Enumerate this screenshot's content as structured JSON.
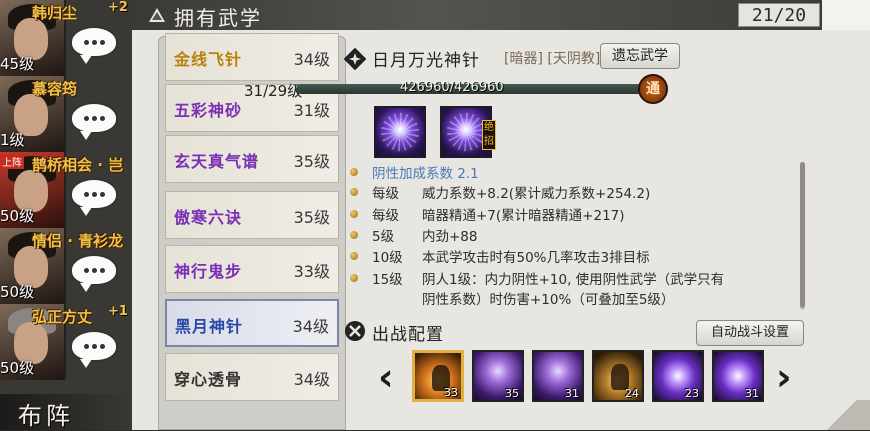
{
  "friends": [
    {
      "name": "韩归尘",
      "level": "45级",
      "extra": "+2",
      "tag": ""
    },
    {
      "name": "慕容筠",
      "level": "1级",
      "extra": "",
      "tag": ""
    },
    {
      "name": "鹊桥相会 · 岂",
      "level": "50级",
      "extra": "",
      "tag": "上阵"
    },
    {
      "name": "情侣 · 青衫龙",
      "level": "50级",
      "extra": "",
      "tag": ""
    },
    {
      "name": "弘正方丈",
      "level": "50级",
      "extra": "+1",
      "tag": ""
    }
  ],
  "formation_label": "布阵",
  "header": {
    "title": "拥有武学",
    "count": "21/20"
  },
  "skills": [
    {
      "name": "金线飞针",
      "level": "34级",
      "color": "gold"
    },
    {
      "name": "五彩神砂",
      "level": "31级",
      "color": "purple"
    },
    {
      "name": "玄天真气谱",
      "level": "35级",
      "color": "purple"
    },
    {
      "name": "傲寒六诀",
      "level": "35级",
      "color": "purple"
    },
    {
      "name": "神行鬼步",
      "level": "33级",
      "color": "purple"
    },
    {
      "name": "黑月神针",
      "level": "34级",
      "color": "blue"
    },
    {
      "name": "穿心透骨",
      "level": "34级",
      "color": "dark"
    }
  ],
  "detail": {
    "name": "日月万光神针",
    "tags": "[暗器] [天阴教]",
    "forget_label": "遗忘武学",
    "level_label": "31/29级",
    "exp_text": "426960/426960",
    "exp_fraction": 1.0,
    "tong_label": "通",
    "ult_label": "绝招"
  },
  "properties": [
    {
      "key": "阴性加成系数",
      "value": "2.1"
    },
    {
      "key": "每级",
      "value": "威力系数+8.2(累计威力系数+254.2)"
    },
    {
      "key": "每级",
      "value": "暗器精通+7(累计暗器精通+217)"
    },
    {
      "key": "5级",
      "value": "内劲+88"
    },
    {
      "key": "10级",
      "value": "本武学攻击时有50%几率攻击3排目标"
    },
    {
      "key": "15级",
      "value": "阴人1级：内力阴性+10, 使用阴性武学（武学只有"
    },
    {
      "key": "",
      "value": "阴性系数）时伤害+10%（可叠加至5级）"
    }
  ],
  "battle": {
    "title": "出战配置",
    "auto_label": "自动战斗设置",
    "slots": [
      {
        "level": "33",
        "style": "orange"
      },
      {
        "level": "35",
        "style": "violet2"
      },
      {
        "level": "31",
        "style": "violet2"
      },
      {
        "level": "24",
        "style": "gold"
      },
      {
        "level": "23",
        "style": "violet"
      },
      {
        "level": "31",
        "style": "violet"
      }
    ]
  }
}
